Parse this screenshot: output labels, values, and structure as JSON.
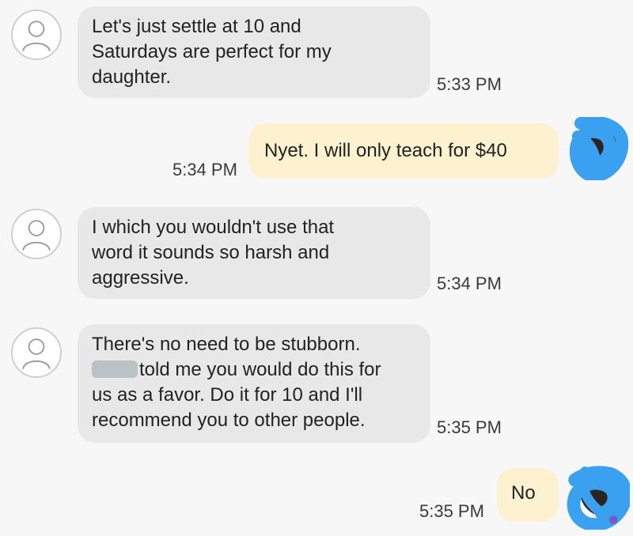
{
  "messages": [
    {
      "direction": "in",
      "text": "Let's just settle at 10 and\nSaturdays are perfect for my\ndaughter.",
      "time": "5:33 PM"
    },
    {
      "direction": "out",
      "text": "Nyet. I will only teach for $40",
      "time": "5:34 PM"
    },
    {
      "direction": "in",
      "text": "I which you wouldn't use that\nword it sounds so harsh and\naggressive.",
      "time": "5:34 PM"
    },
    {
      "direction": "in",
      "line1": "There's no need to be stubborn.",
      "line2_after_redaction": "told me you would do this for",
      "line3": "us as a favor.  Do it for 10 and I'll",
      "line4": "recommend you to other people.",
      "time": "5:35 PM"
    },
    {
      "direction": "out",
      "text": "No",
      "time": "5:35 PM"
    }
  ],
  "icons": {
    "contact_avatar": "person-outline-icon",
    "self_avatar": "scribbled-out-avatar-icon"
  },
  "colors": {
    "incoming_bubble": "#e8e8e8",
    "outgoing_bubble": "#fdf1cf",
    "scribble": "#3aa0f0",
    "background": "#f7f7f7"
  }
}
